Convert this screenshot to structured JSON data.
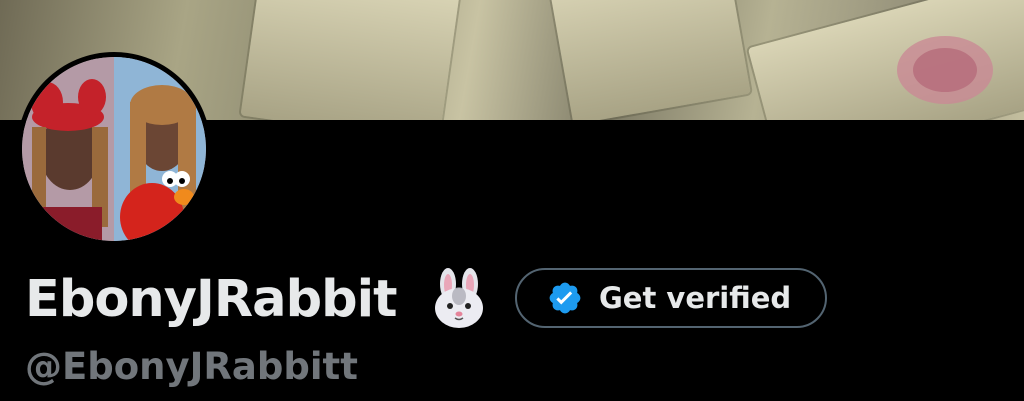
{
  "profile": {
    "display_name": "EbonyJRabbit",
    "name_emoji": "rabbit-face-icon",
    "handle": "@EbonyJRabbitt",
    "banner_image": "money-bills-banner",
    "avatar_image": "profile-photo-collage"
  },
  "verify_button": {
    "label": "Get verified",
    "icon": "verified-badge-icon"
  },
  "colors": {
    "background": "#000000",
    "name_text": "#e7e9ea",
    "handle_text": "#71767b",
    "button_border": "#536471",
    "verified_blue": "#1d9bf0"
  }
}
